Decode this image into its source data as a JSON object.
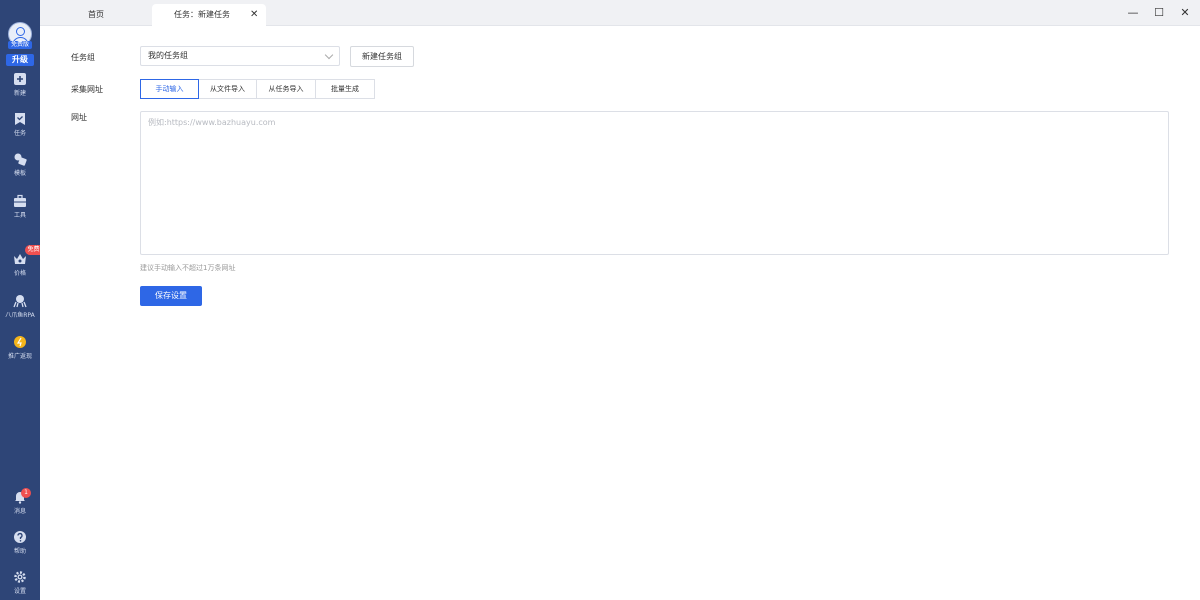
{
  "sidebar": {
    "avatar_tag": "免费版",
    "upgrade_label": "升级",
    "items": [
      {
        "label": "新建",
        "icon": "plus-square-icon"
      },
      {
        "label": "任务",
        "icon": "bookmark-task-icon"
      },
      {
        "label": "模板",
        "icon": "template-icon"
      },
      {
        "label": "工具",
        "icon": "toolbox-icon"
      },
      {
        "label": "价格",
        "icon": "crown-icon"
      },
      {
        "label": "八爪鱼RPA",
        "icon": "octopus-icon"
      },
      {
        "label": "推广返现",
        "icon": "coin-icon"
      },
      {
        "label": "消息",
        "icon": "bell-icon"
      },
      {
        "label": "帮助",
        "icon": "help-icon"
      },
      {
        "label": "设置",
        "icon": "gear-icon"
      }
    ],
    "trial_badge": "免费试用",
    "message_count": "1"
  },
  "tabs": {
    "home": "首页",
    "active": "任务：新建任务"
  },
  "form": {
    "group_label": "任务组",
    "group_value": "我的任务组",
    "new_group_button": "新建任务组",
    "collect_label": "采集网址",
    "input_modes": [
      "手动输入",
      "从文件导入",
      "从任务导入",
      "批量生成"
    ],
    "url_label": "网址",
    "url_placeholder": "例如:https://www.bazhuayu.com",
    "hint": "建议手动输入不超过1万条网址",
    "save_button": "保存设置"
  },
  "colors": {
    "sidebar_bg": "#2e4577",
    "accent": "#2e67e6",
    "badge_red": "#f05050"
  }
}
